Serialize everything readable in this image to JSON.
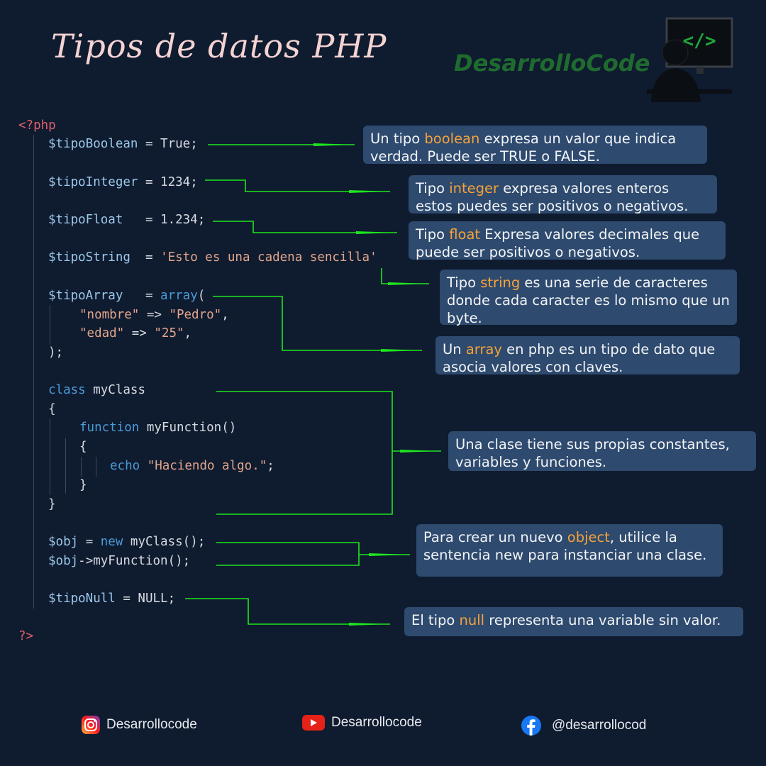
{
  "title": "Tipos de datos PHP",
  "brand": "DesarrolloCode",
  "logo_icon": "monitor-code-icon",
  "logo_code": "</>",
  "code": {
    "open_tag": "<?php",
    "close_tag": "?>",
    "bool_var": "$tipoBoolean",
    "bool_val": " = True;",
    "int_var": "$tipoInteger",
    "int_val": " = 1234;",
    "float_var": "$tipoFloat",
    "float_val": "   = 1.234;",
    "string_var": "$tipoString",
    "string_eq": "  = ",
    "string_val": "'Esto es una cadena sencilla'",
    "array_var": "$tipoArray",
    "array_eq": "   = ",
    "array_kw": "array",
    "array_paren": "(",
    "array_k1": "\"nombre\"",
    "array_v1": "\"Pedro\"",
    "array_k2": "\"edad\"",
    "array_v2": "\"25\"",
    "arrow_op": " => ",
    "comma": ",",
    "array_close": ");",
    "class_kw": "class",
    "class_name": " myClass",
    "brace_open": "{",
    "brace_close": "}",
    "function_kw": "function",
    "function_name": " myFunction()",
    "echo_kw": "echo",
    "echo_str": "\"Haciendo algo.\"",
    "semicolon": ";",
    "obj_var": "$obj",
    "obj_eq": " = ",
    "new_kw": "new",
    "obj_new": " myClass();",
    "obj_call": "->myFunction();",
    "null_var": "$tipoNull",
    "null_val": " = NULL;"
  },
  "boxes": {
    "boolean": {
      "pre": "Un tipo ",
      "hl": "boolean",
      "post": " expresa un valor que indica verdad. Puede ser TRUE o FALSE."
    },
    "integer": {
      "pre": "Tipo ",
      "hl": "integer",
      "post": " expresa valores enteros estos puedes ser positivos o negativos."
    },
    "float": {
      "pre": "Tipo ",
      "hl": "float",
      "post": " Expresa valores decimales que puede ser positivos o negativos."
    },
    "string": {
      "pre": "Tipo ",
      "hl": "string",
      "post": " es una serie de caracteres donde cada caracter es lo mismo que un byte."
    },
    "array": {
      "pre": "Un ",
      "hl": "array",
      "post": " en php es un tipo de dato que asocia valores con claves."
    },
    "class": {
      "pre": "Una clase tiene sus propias constantes, variables y funciones.",
      "hl": "",
      "post": ""
    },
    "object": {
      "pre": "Para crear un nuevo ",
      "hl": "object",
      "post": ", utilice la sentencia new para instanciar una clase."
    },
    "null": {
      "pre": "El tipo ",
      "hl": "null",
      "post": " representa una variable sin valor."
    }
  },
  "social": {
    "instagram": {
      "icon": "instagram-icon",
      "label": "Desarrollocode"
    },
    "youtube": {
      "icon": "youtube-icon",
      "label": "Desarrollocode"
    },
    "facebook": {
      "icon": "facebook-icon",
      "label": "@desarrollocod"
    }
  },
  "colors": {
    "background": "#0f1b2f",
    "box": "#2e4a6e",
    "highlight": "#f5a23a",
    "arrow": "#1ee61e",
    "brand": "#1f6b2f"
  }
}
